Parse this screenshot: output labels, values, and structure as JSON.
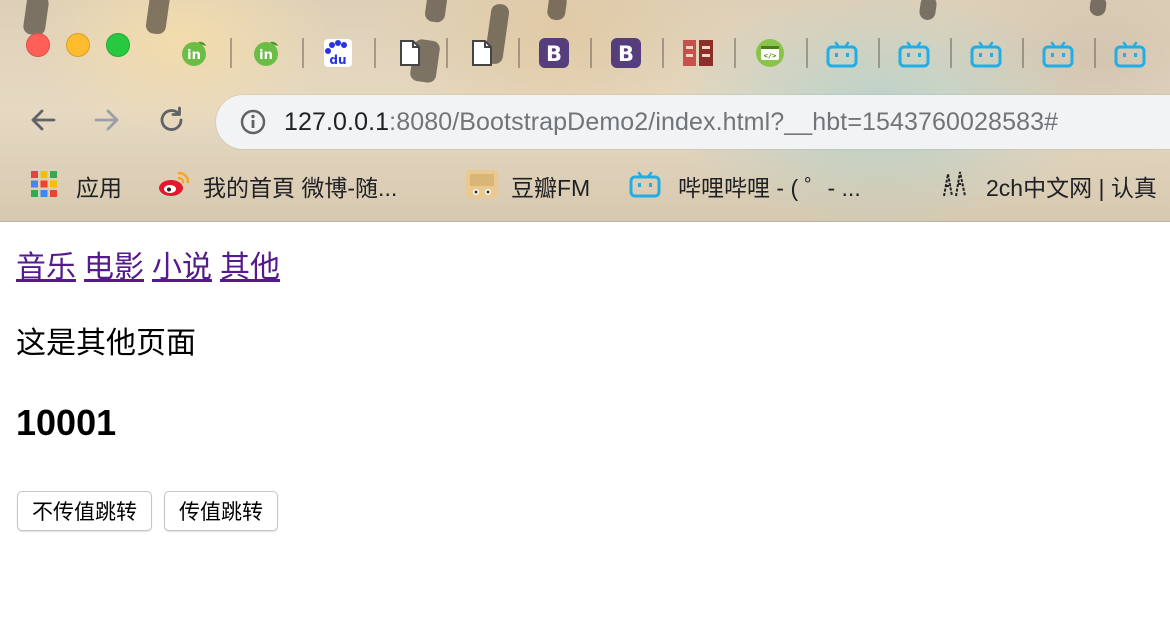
{
  "browser": {
    "tab_icons": [
      "invision-icon",
      "invision-icon",
      "baidu-icon",
      "blank-page-icon",
      "blank-page-icon",
      "bootstrap-icon",
      "bootstrap-icon",
      "fb-logo-icon",
      "code-editor-icon",
      "bilibili-icon",
      "bilibili-icon",
      "bilibili-icon",
      "bilibili-icon",
      "bilibili-icon"
    ],
    "url_host": "127.0.0.1",
    "url_rest": ":8080/BootstrapDemo2/index.html?__hbt=1543760028583#",
    "bookmarks": [
      {
        "label": "应用",
        "icon": "apps-grid-icon"
      },
      {
        "label": "我的首頁 微博-随...",
        "icon": "weibo-icon"
      },
      {
        "label": "豆瓣FM",
        "icon": "douban-fm-icon"
      },
      {
        "label": "哔哩哔哩 - ( ゜- ...",
        "icon": "bilibili-icon"
      },
      {
        "label": "2ch中文网 | 认真",
        "icon": "2ch-icon"
      }
    ]
  },
  "page": {
    "nav_links": [
      "音乐",
      "电影",
      "小说",
      "其他"
    ],
    "text": "这是其他页面",
    "heading": "10001",
    "buttons": {
      "no_param_jump": "不传值跳转",
      "param_jump": "传值跳转"
    }
  },
  "colors": {
    "link_visited": "#551a8b",
    "address_bar_bg": "#f1f3f4",
    "bilibili_blue": "#23ade5",
    "bootstrap_purple": "#563d7c"
  }
}
